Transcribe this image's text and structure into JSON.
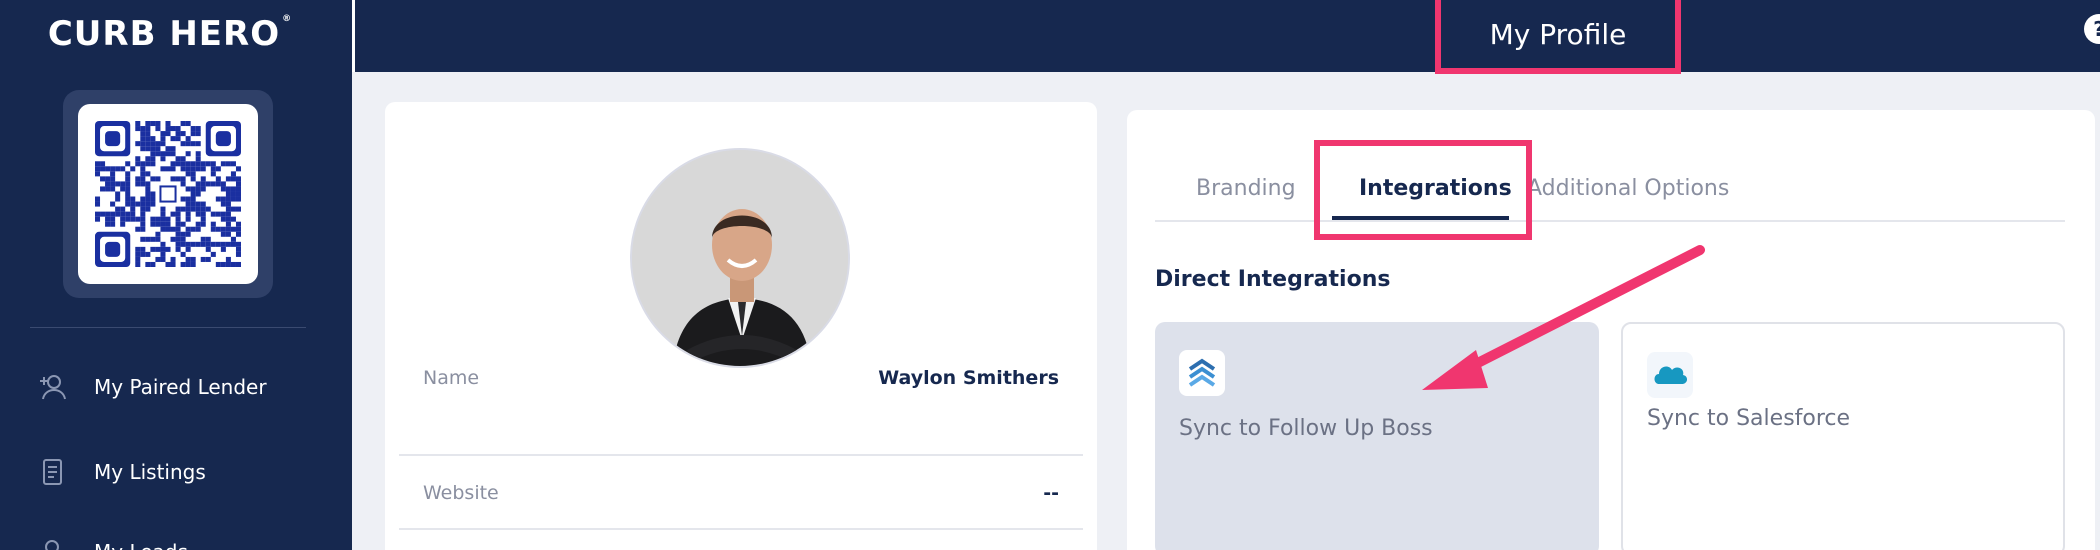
{
  "sidebar": {
    "logo": "CURB HERO",
    "logo_mark": "®",
    "nav_items": [
      {
        "label": "My Paired Lender",
        "icon": "add-user-icon"
      },
      {
        "label": "My Listings",
        "icon": "document-icon"
      },
      {
        "label": "My Leads",
        "icon": "leads-icon"
      }
    ]
  },
  "header": {
    "title": "My Profile",
    "help": "?"
  },
  "profile": {
    "fields": [
      {
        "label": "Name",
        "value": "Waylon Smithers"
      },
      {
        "label": "Website",
        "value": "--"
      }
    ]
  },
  "integrations": {
    "tabs": [
      {
        "label": "Branding",
        "active": false
      },
      {
        "label": "Integrations",
        "active": true
      },
      {
        "label": "Additional Options",
        "active": false
      }
    ],
    "section_title": "Direct Integrations",
    "items": [
      {
        "label": "Sync to Follow Up Boss",
        "icon": "follow-up-boss-icon",
        "selected": true
      },
      {
        "label": "Sync to Salesforce",
        "icon": "salesforce-icon",
        "selected": false
      }
    ]
  },
  "colors": {
    "navy": "#16284f",
    "highlight": "#f0366f",
    "tile_selected": "#dde1eb"
  }
}
